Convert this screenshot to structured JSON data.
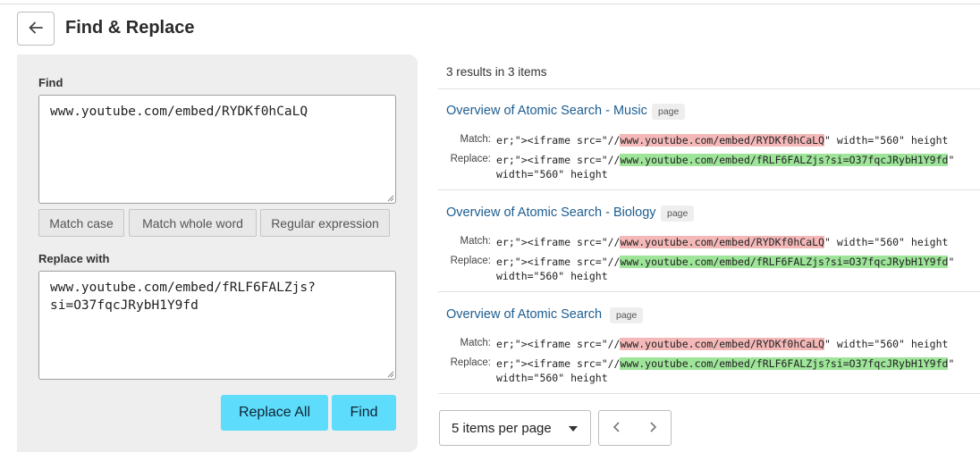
{
  "header": {
    "title": "Find & Replace",
    "back_icon": "arrow-left-icon"
  },
  "find": {
    "label": "Find",
    "value": "www.youtube.com/embed/RYDKf0hCaLQ"
  },
  "options": {
    "match_case": "Match case",
    "match_whole_word": "Match whole word",
    "regular_expression": "Regular expression"
  },
  "replace": {
    "label": "Replace with",
    "value": "www.youtube.com/embed/fRLF6FALZjs?\nsi=O37fqcJRybH1Y9fd"
  },
  "actions": {
    "replace_all": "Replace All",
    "find": "Find"
  },
  "results": {
    "summary": "3 results in 3 items",
    "match_label": "Match:",
    "replace_label": "Replace:",
    "items": [
      {
        "title": "Overview of Atomic Search - Music",
        "badge": "page",
        "match_prefix": "er;\"><iframe src=\"//",
        "match_hit": "www.youtube.com/embed/RYDKf0hCaLQ",
        "match_suffix": "\" width=\"560\" height",
        "replace_prefix": "er;\"><iframe src=\"//",
        "replace_hit": "www.youtube.com/embed/fRLF6FALZjs?si=O37fqcJRybH1Y9fd",
        "replace_suffix": "\"",
        "replace_line2": "width=\"560\" height"
      },
      {
        "title": "Overview of Atomic Search - Biology",
        "badge": "page",
        "match_prefix": "er;\"><iframe src=\"//",
        "match_hit": "www.youtube.com/embed/RYDKf0hCaLQ",
        "match_suffix": "\" width=\"560\" height",
        "replace_prefix": "er;\"><iframe src=\"//",
        "replace_hit": "www.youtube.com/embed/fRLF6FALZjs?si=O37fqcJRybH1Y9fd",
        "replace_suffix": "\"",
        "replace_line2": "width=\"560\" height"
      },
      {
        "title": "Overview of Atomic Search",
        "badge": "page",
        "match_prefix": "er;\"><iframe src=\"//",
        "match_hit": "www.youtube.com/embed/RYDKf0hCaLQ",
        "match_suffix": "\" width=\"560\" height",
        "replace_prefix": "er;\"><iframe src=\"//",
        "replace_hit": "www.youtube.com/embed/fRLF6FALZjs?si=O37fqcJRybH1Y9fd",
        "replace_suffix": "\"",
        "replace_line2": "width=\"560\" height"
      }
    ]
  },
  "pagination": {
    "per_page": "5 items per page",
    "prev_icon": "chevron-left-icon",
    "next_icon": "chevron-right-icon"
  },
  "colors": {
    "accent": "#5ddcfb",
    "link": "#1c5d91",
    "match_highlight": "#f5b8b8",
    "replace_highlight": "#9ee59a"
  }
}
